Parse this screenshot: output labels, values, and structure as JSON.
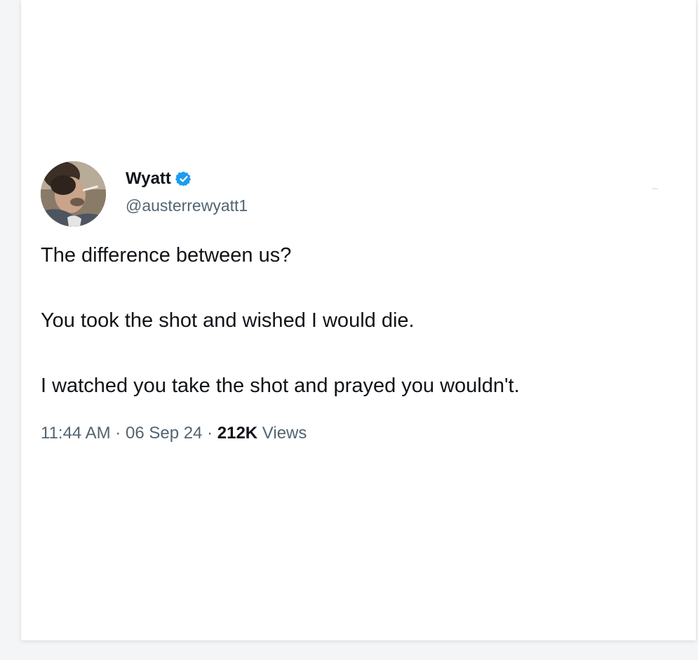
{
  "tweet": {
    "author": {
      "display_name": "Wyatt",
      "handle": "@austerrewyatt1",
      "verified": true,
      "verified_color": "#1d9bf0"
    },
    "text_lines": [
      "The difference between us?",
      "You took the shot and wished I would die.",
      "I watched you take the shot and prayed you wouldn't."
    ],
    "meta": {
      "time": "11:44 AM",
      "separator": "·",
      "date": "06 Sep 24",
      "views_count": "212K",
      "views_label": "Views"
    }
  },
  "icons": {
    "verified": "verified-badge-icon",
    "avatar": "profile-photo"
  }
}
